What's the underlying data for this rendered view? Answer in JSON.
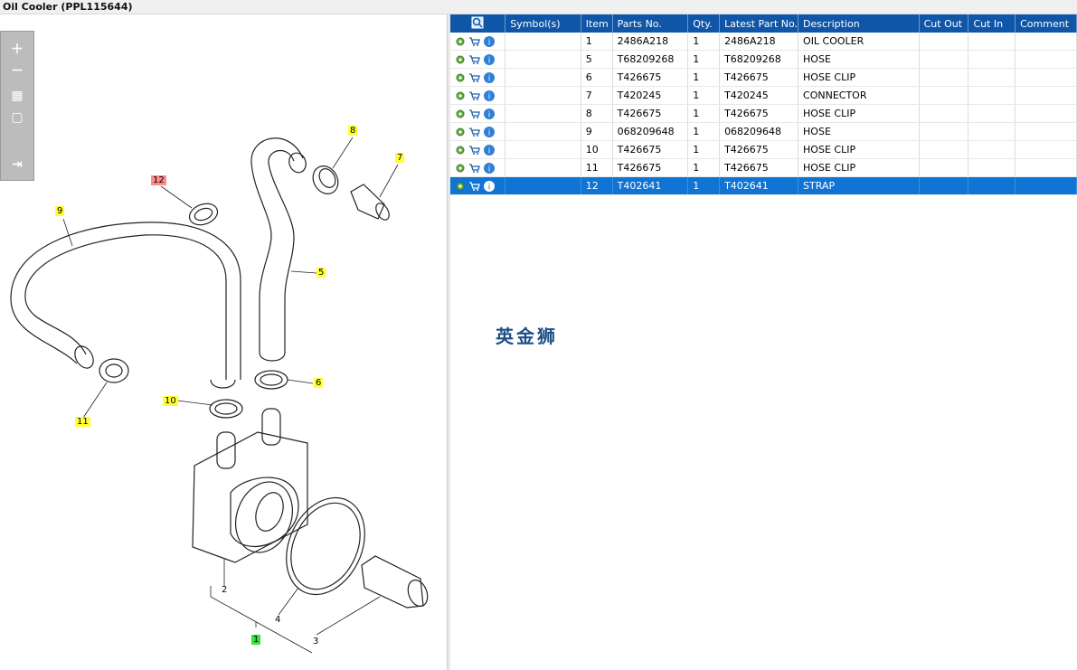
{
  "window": {
    "title": "Oil Cooler (PPL115644)"
  },
  "toolbar": {
    "buttons": [
      {
        "name": "zoom-in-button",
        "icon": "plus-icon"
      },
      {
        "name": "zoom-out-button",
        "icon": "minus-icon"
      },
      {
        "name": "fit-all-button",
        "icon": "grid-icon"
      },
      {
        "name": "fit-window-button",
        "icon": "square-icon"
      },
      {
        "name": "export-button",
        "icon": "export-icon"
      }
    ]
  },
  "callouts": [
    {
      "label": "8",
      "color": "yellow"
    },
    {
      "label": "7",
      "color": "yellow"
    },
    {
      "label": "12",
      "color": "red"
    },
    {
      "label": "9",
      "color": "yellow"
    },
    {
      "label": "5",
      "color": "yellow"
    },
    {
      "label": "6",
      "color": "yellow"
    },
    {
      "label": "10",
      "color": "yellow"
    },
    {
      "label": "11",
      "color": "yellow"
    },
    {
      "label": "2",
      "color": "none"
    },
    {
      "label": "4",
      "color": "none"
    },
    {
      "label": "3",
      "color": "none"
    },
    {
      "label": "1",
      "color": "green"
    }
  ],
  "table": {
    "columns": [
      "Symbol(s)",
      "Item",
      "Parts No.",
      "Qty.",
      "Latest Part No.",
      "Description",
      "Cut Out",
      "Cut In",
      "Comment"
    ],
    "rows": [
      {
        "item": "1",
        "part_no": "2486A218",
        "qty": "1",
        "latest": "2486A218",
        "desc": "OIL COOLER",
        "cut_out": "",
        "cut_in": "",
        "comment": ""
      },
      {
        "item": "5",
        "part_no": "T68209268",
        "qty": "1",
        "latest": "T68209268",
        "desc": "HOSE",
        "cut_out": "",
        "cut_in": "",
        "comment": ""
      },
      {
        "item": "6",
        "part_no": "T426675",
        "qty": "1",
        "latest": "T426675",
        "desc": "HOSE CLIP",
        "cut_out": "",
        "cut_in": "",
        "comment": ""
      },
      {
        "item": "7",
        "part_no": "T420245",
        "qty": "1",
        "latest": "T420245",
        "desc": "CONNECTOR",
        "cut_out": "",
        "cut_in": "",
        "comment": ""
      },
      {
        "item": "8",
        "part_no": "T426675",
        "qty": "1",
        "latest": "T426675",
        "desc": "HOSE CLIP",
        "cut_out": "",
        "cut_in": "",
        "comment": ""
      },
      {
        "item": "9",
        "part_no": "068209648",
        "qty": "1",
        "latest": "068209648",
        "desc": "HOSE",
        "cut_out": "",
        "cut_in": "",
        "comment": ""
      },
      {
        "item": "10",
        "part_no": "T426675",
        "qty": "1",
        "latest": "T426675",
        "desc": "HOSE CLIP",
        "cut_out": "",
        "cut_in": "",
        "comment": ""
      },
      {
        "item": "11",
        "part_no": "T426675",
        "qty": "1",
        "latest": "T426675",
        "desc": "HOSE CLIP",
        "cut_out": "",
        "cut_in": "",
        "comment": ""
      },
      {
        "item": "12",
        "part_no": "T402641",
        "qty": "1",
        "latest": "T402641",
        "desc": "STRAP",
        "cut_out": "",
        "cut_in": "",
        "comment": ""
      }
    ],
    "selected_item": "12"
  },
  "watermark": {
    "text": "英金狮"
  },
  "colors": {
    "header": "#0f56a8",
    "selection": "#0f74d4",
    "callout_yellow": "#ffff33",
    "callout_red": "#ff8a8a",
    "callout_green": "#38e038"
  }
}
